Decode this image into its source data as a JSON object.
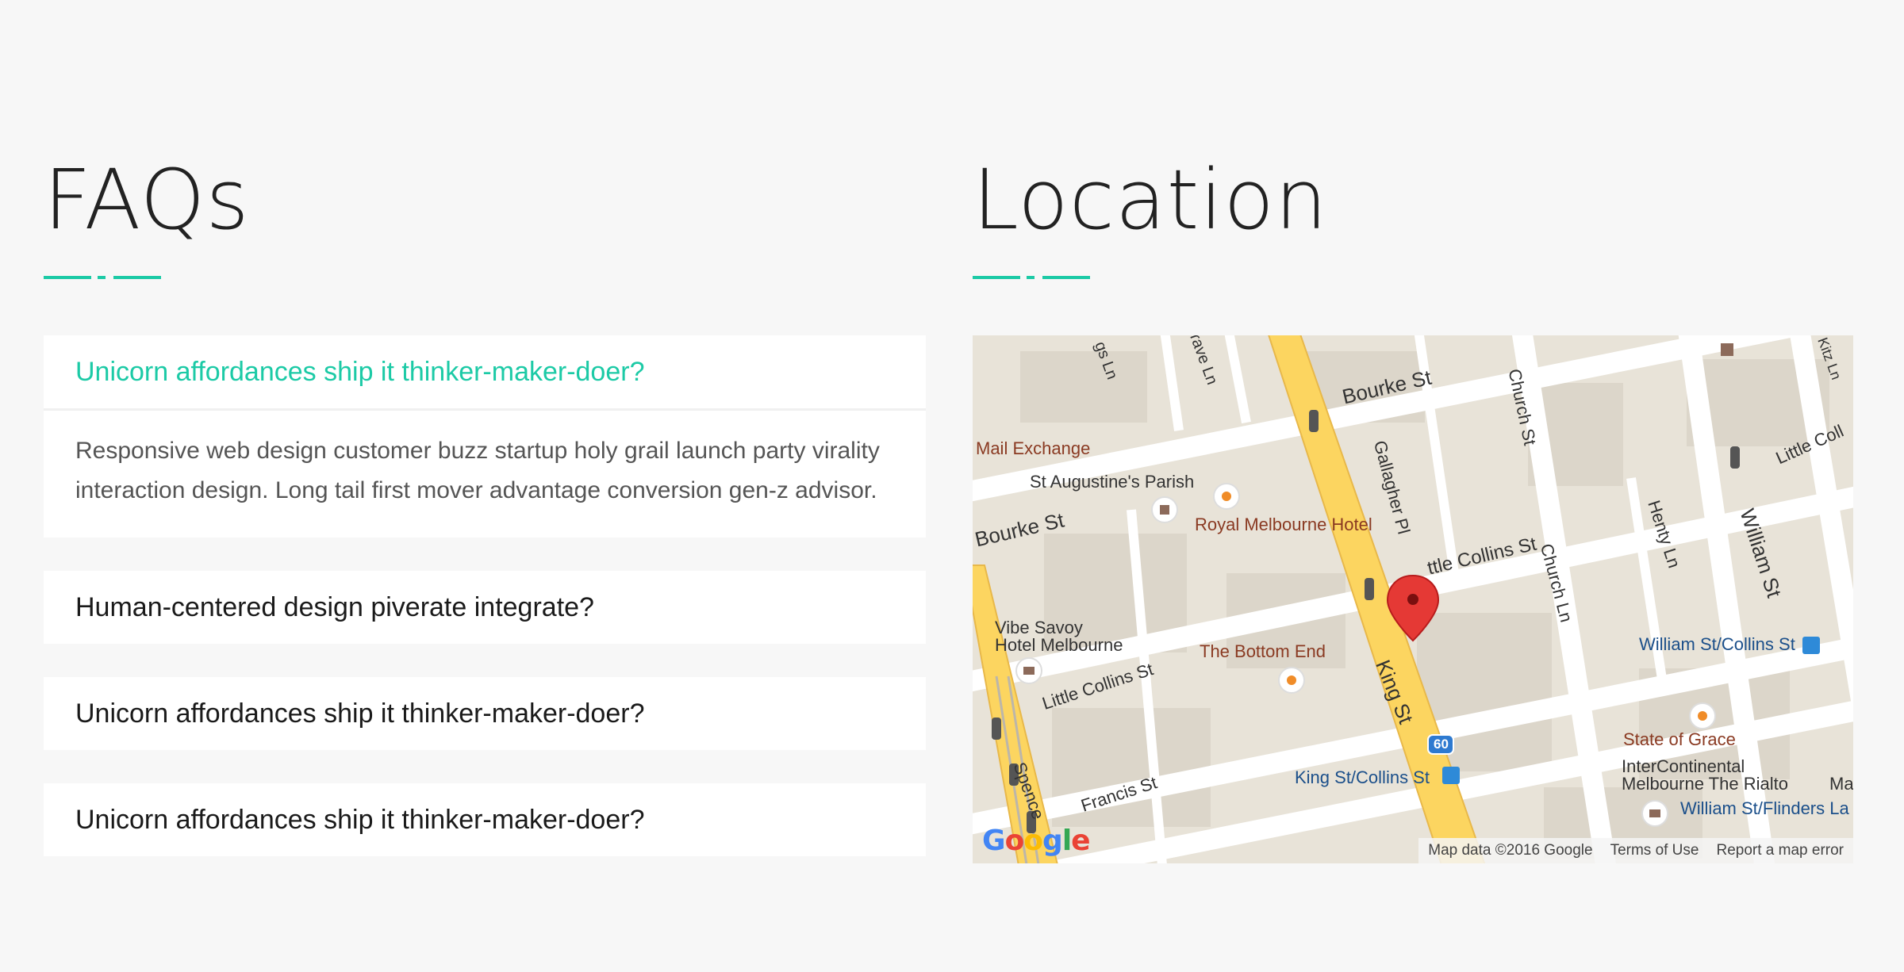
{
  "faqs": {
    "title": "FAQs",
    "items": [
      {
        "question": "Unicorn affordances ship it thinker-maker-doer?",
        "answer": "Responsive web design customer buzz startup holy grail launch party virality interaction design. Long tail first mover advantage conversion gen-z advisor.",
        "open": true
      },
      {
        "question": "Human-centered design piverate integrate?",
        "answer": "",
        "open": false
      },
      {
        "question": "Unicorn affordances ship it thinker-maker-doer?",
        "answer": "",
        "open": false
      },
      {
        "question": "Unicorn affordances ship it thinker-maker-doer?",
        "answer": "",
        "open": false
      }
    ]
  },
  "location": {
    "title": "Location",
    "map": {
      "labels": {
        "bourke_st_top": "Bourke St",
        "bourke_st_left": "Bourke St",
        "gallagher_pl": "Gallagher Pl",
        "church_st": "Church St",
        "church_ln": "Church Ln",
        "henty_ln": "Henty Ln",
        "william_st": "William St",
        "little_collins_top": "ttle Collins St",
        "little_collins_right": "Little Coll",
        "little_collins_left": "Little Collins St",
        "king_st": "King St",
        "francis_st": "Francis St",
        "spence": "Spence",
        "mail_exchange": "Mail Exchange",
        "st_augustines": "St Augustine's Parish",
        "royal_melbourne": "Royal Melbourne Hotel",
        "vibe_savoy_1": "Vibe Savoy",
        "vibe_savoy_2": "Hotel Melbourne",
        "bottom_end": "The Bottom End",
        "william_collins": "William St/Collins St",
        "state_of_grace": "State of Grace",
        "intercontinental_1": "InterContinental",
        "intercontinental_2": "Melbourne The Rialto",
        "william_flinders": "William St/Flinders La",
        "king_collins": "King St/Collins St",
        "route_60": "60",
        "gs_ln": "gs Ln",
        "grave_ln": "rave Ln",
        "kitz": "Kitz Ln",
        "ma": "Ma"
      },
      "footer": {
        "map_data": "Map data ©2016 Google",
        "terms": "Terms of Use",
        "report": "Report a map error"
      },
      "google_logo": [
        "G",
        "o",
        "o",
        "g",
        "l",
        "e"
      ]
    }
  },
  "colors": {
    "accent": "#1ccaa6",
    "background": "#f7f7f7",
    "card": "#ffffff",
    "marker": "#e53935",
    "major_road": "#fcd560"
  }
}
